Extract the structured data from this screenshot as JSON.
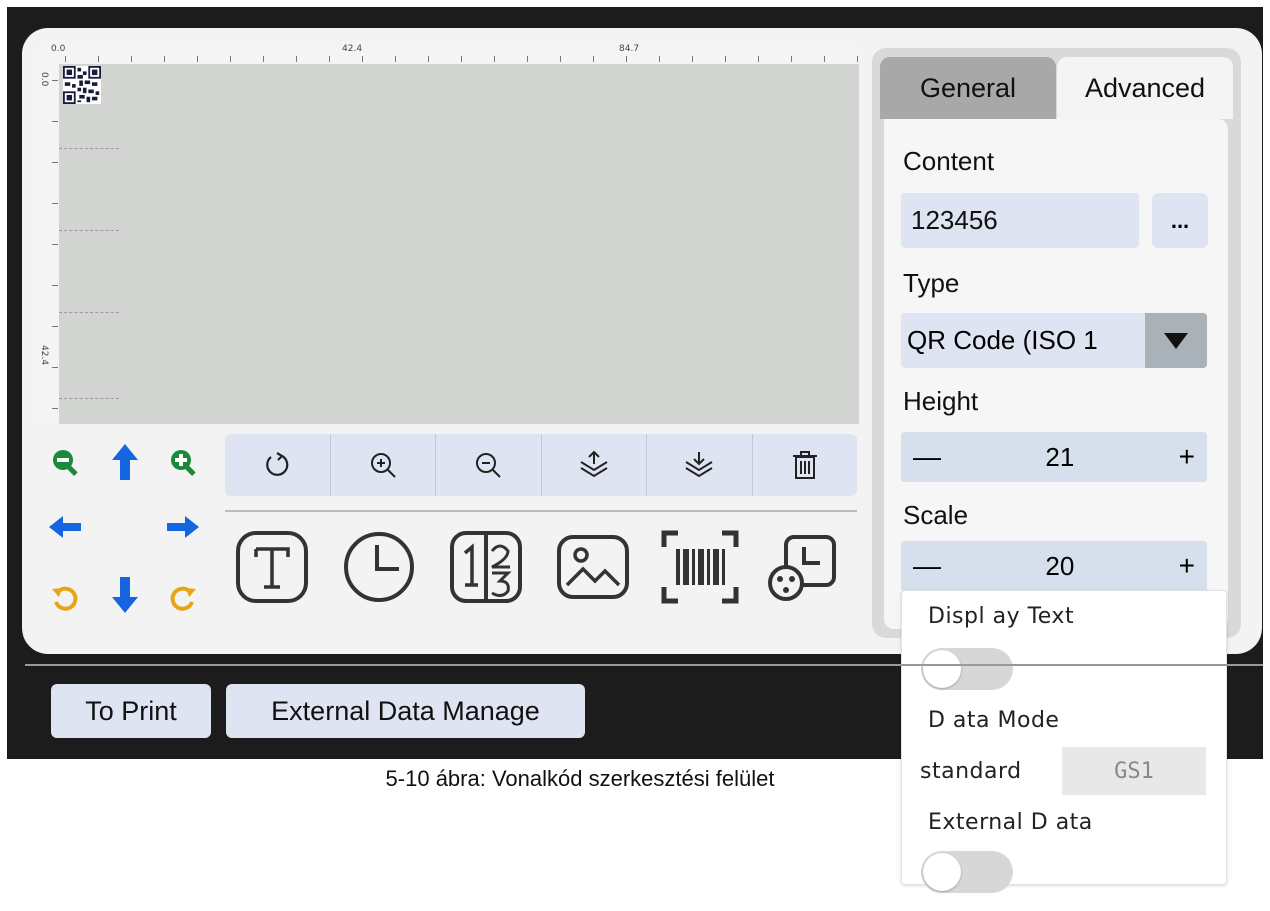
{
  "ruler": {
    "top": [
      "0.0",
      "42.4",
      "84.7"
    ],
    "left": [
      "0.0",
      "42.4"
    ]
  },
  "tabs": {
    "general": "General",
    "advanced": "Advanced"
  },
  "properties": {
    "content_label": "Content",
    "content_value": "123456",
    "more_button": "...",
    "type_label": "Type",
    "type_value": "QR Code (ISO 1",
    "height_label": "Height",
    "height_value": "21",
    "scale_label": "Scale",
    "scale_value": "20",
    "minus": "—",
    "plus": "+"
  },
  "popup": {
    "display_text_label": "Displ ay Text",
    "display_text_on": false,
    "data_mode_label": "D ata Mode",
    "data_mode_value": "standard",
    "data_mode_option": "GS1",
    "external_data_label": "External D ata",
    "external_data_on": false
  },
  "bottom": {
    "to_print": "To Print",
    "external_data_manage": "External Data Manage"
  },
  "caption": "5-10 ábra: Vonalkód szerkesztési felület",
  "icons": {
    "nav": [
      "zoom-out-icon",
      "arrow-up-icon",
      "zoom-in-icon",
      "arrow-left-icon",
      "arrow-right-icon",
      "rotate-left-icon",
      "arrow-down-icon",
      "rotate-right-icon"
    ],
    "toolbar": [
      "refresh-icon",
      "zoom-in-icon",
      "zoom-out-icon",
      "layer-up-icon",
      "layer-down-icon",
      "delete-icon"
    ],
    "tools": [
      "text-icon",
      "clock-icon",
      "counter-icon",
      "image-icon",
      "barcode-icon",
      "shift-clock-icon"
    ]
  },
  "colors": {
    "green": "#1a8a3a",
    "blue": "#1565e0",
    "orange": "#e8a317",
    "tab_active": "#a8a8a8",
    "field": "#dfe4f2"
  }
}
